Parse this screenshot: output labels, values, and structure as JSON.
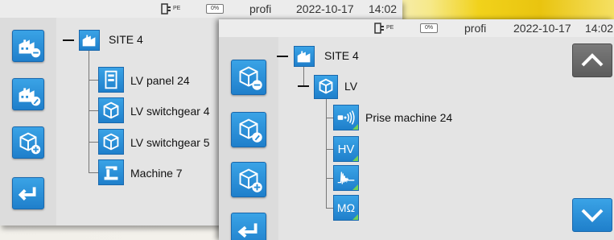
{
  "back_screen": {
    "statusbar": {
      "pe_label": "PE",
      "battery": "0%",
      "mode": "profi",
      "date": "2022-10-17",
      "time": "14:02"
    },
    "sidebar_buttons": [
      "factory-minus-icon",
      "factory-edit-icon",
      "cube-add-icon",
      "back-arrow-icon"
    ],
    "tree": {
      "root": "SITE 4",
      "children": [
        "LV panel 24",
        "LV switchgear 4",
        "LV switchgear 5",
        "Machine 7"
      ]
    }
  },
  "front_screen": {
    "statusbar": {
      "pe_label": "PE",
      "battery": "0%",
      "mode": "profi",
      "date": "2022-10-17",
      "time": "14:02"
    },
    "sidebar_buttons": [
      "cube-minus-icon",
      "cube-edit-icon",
      "cube-add-icon",
      "back-arrow-icon"
    ],
    "tree": {
      "root": "SITE 4",
      "child": "LV",
      "grandchildren": [
        {
          "icon": "sound-sensor-icon",
          "label": "Prise machine 24"
        },
        {
          "icon": "hv-icon",
          "badge": "HV"
        },
        {
          "icon": "waveform-icon"
        },
        {
          "icon": "megohm-icon",
          "badge": "MΩ"
        }
      ]
    },
    "scroll": {
      "up_icon": "chevron-up-icon",
      "down_icon": "chevron-down-icon"
    }
  },
  "colors": {
    "button_blue": "#2a8fd8",
    "scroll_gray": "#6b6b6b",
    "accent_green": "#6fd15a",
    "background_yellow": "#f1d21b"
  }
}
